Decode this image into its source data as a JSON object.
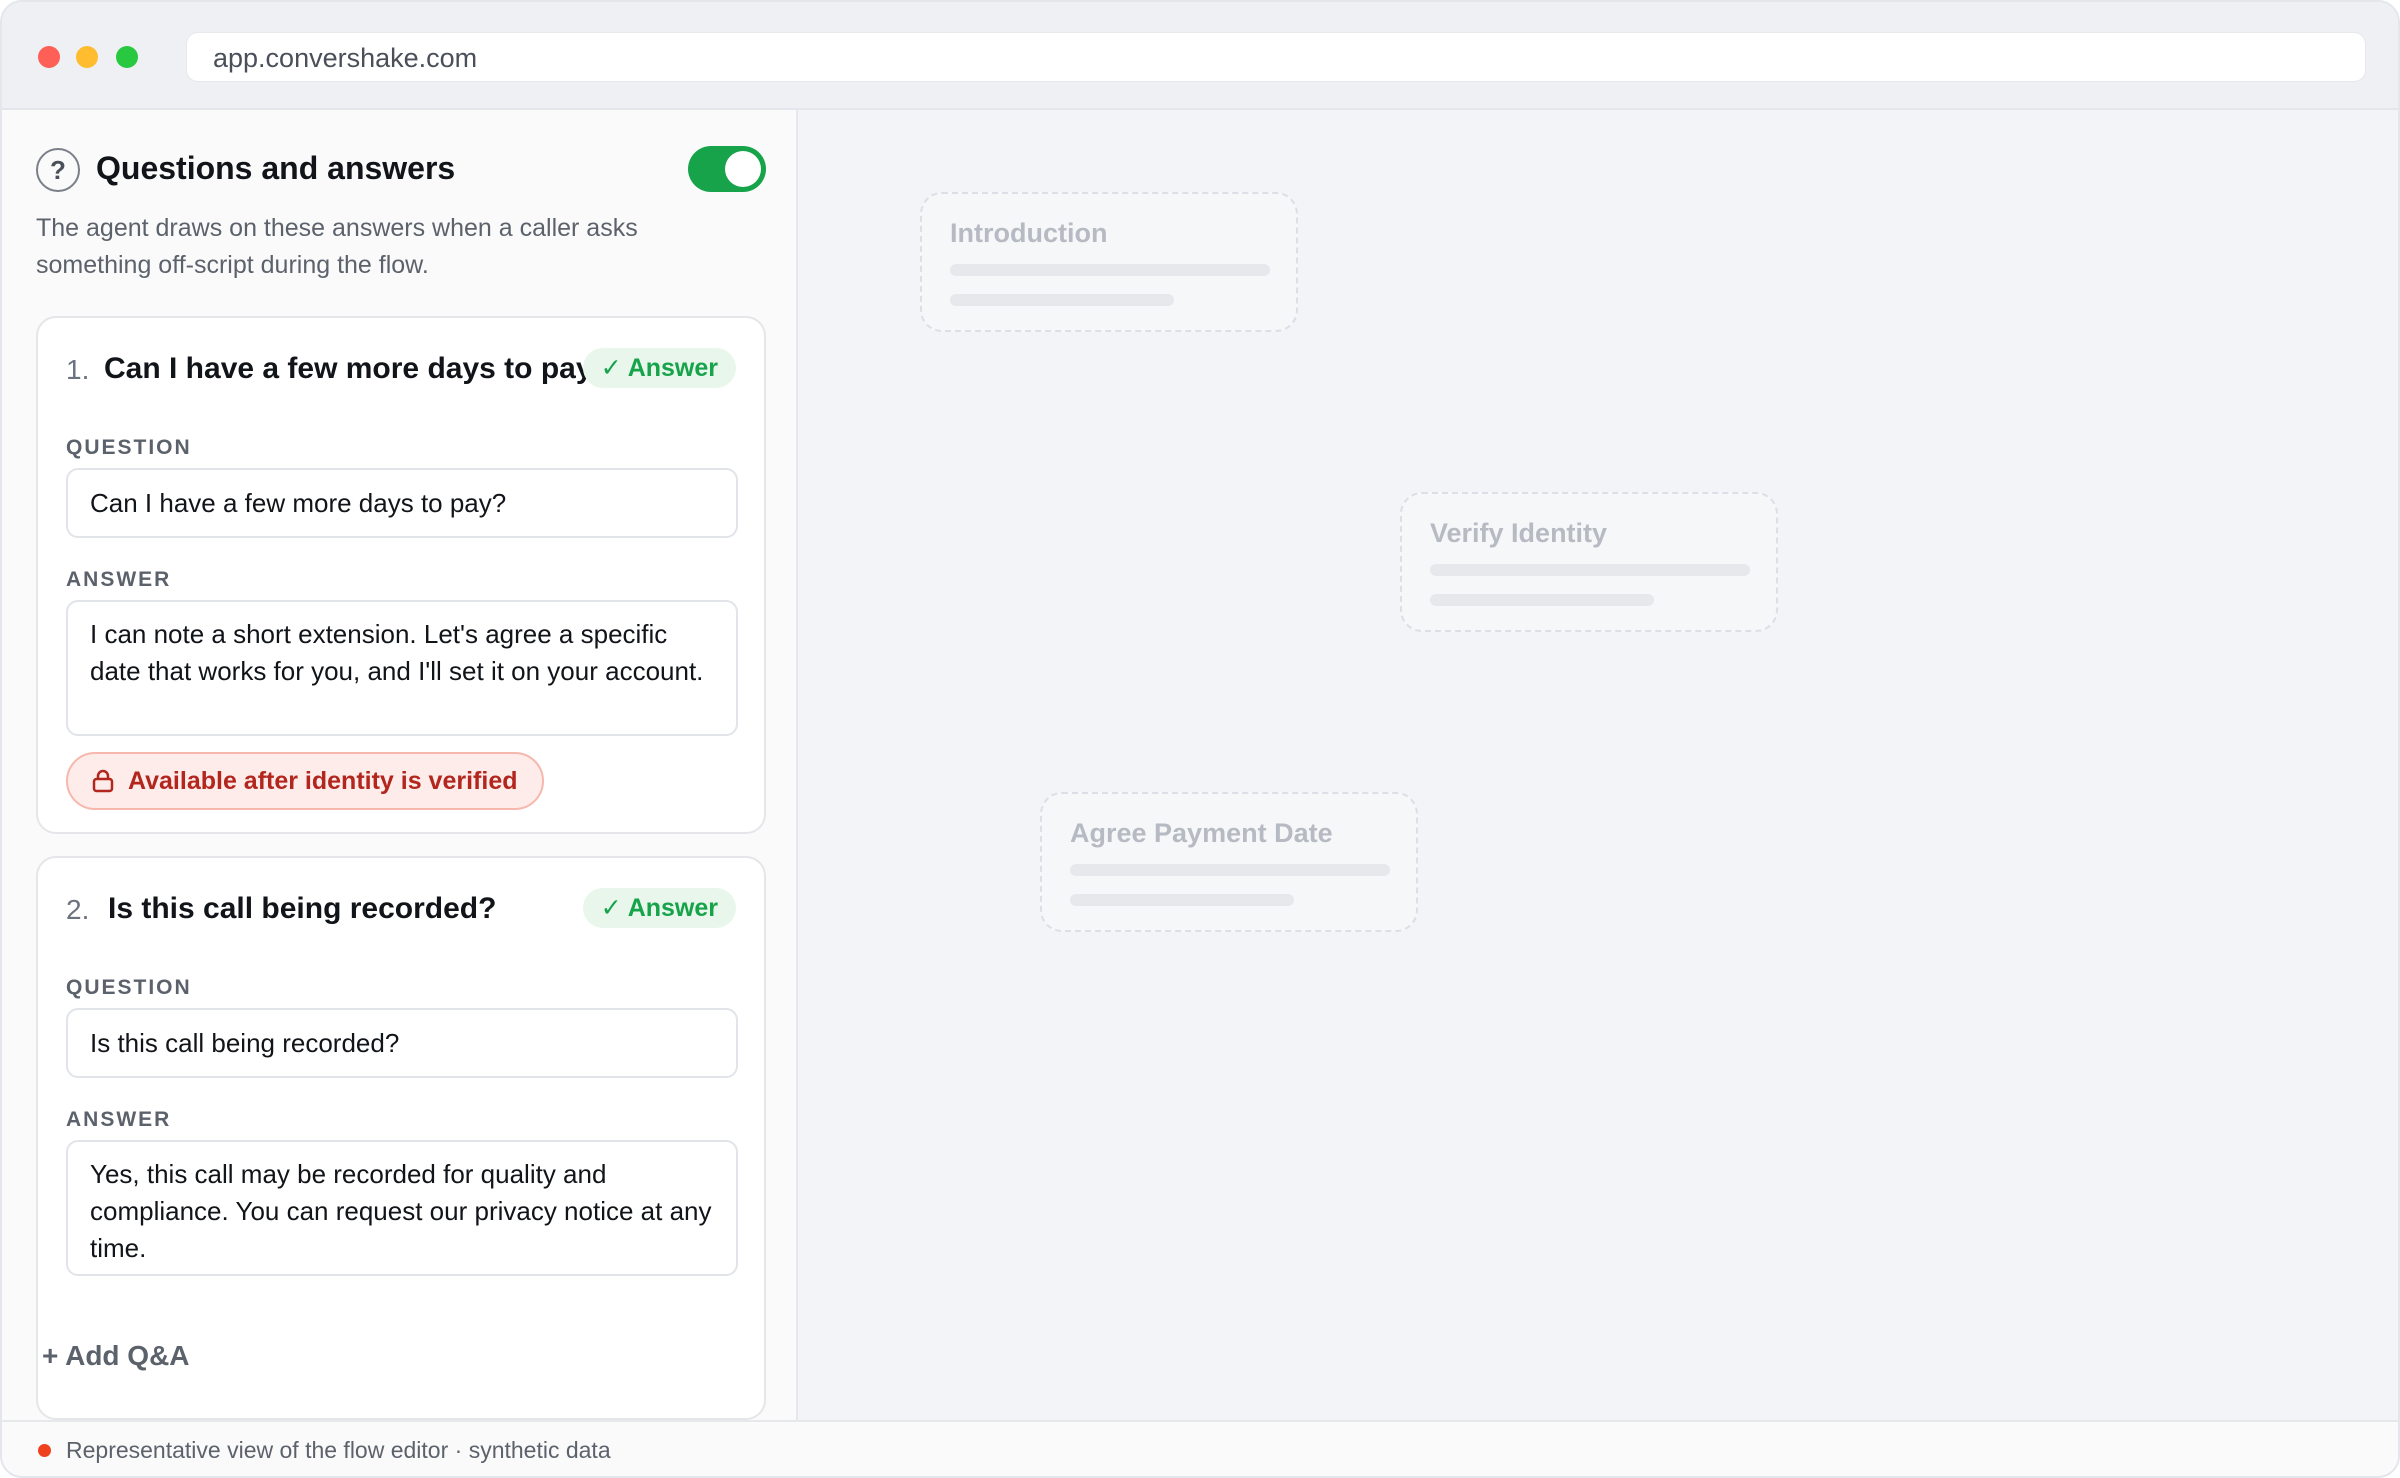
{
  "browser": {
    "url": "app.convershake.com"
  },
  "panel": {
    "title": "Questions and answers",
    "description": "The agent draws on these answers when a caller asks something off-script during the flow.",
    "toggle_on": true,
    "help_icon": "question-circle-icon",
    "help_glyph": "?"
  },
  "qa_items": [
    {
      "number": "1.",
      "title": "Can I have a few more days to pay?",
      "badge": "Answer",
      "question_label": "QUESTION",
      "question": "Can I have a few more days to pay?",
      "answer_label": "ANSWER",
      "answer": "I can note a short extension. Let's agree a specific date that works for you, and I'll set it on your account.",
      "condition": "Available after identity is verified"
    },
    {
      "number": "2.",
      "title": "Is this call being recorded?",
      "badge": "Answer",
      "question_label": "QUESTION",
      "question": "Is this call being recorded?",
      "answer_label": "ANSWER",
      "answer": "Yes, this call may be recorded for quality and compliance. You can request our privacy notice at any time."
    }
  ],
  "add_button": "+ Add Q&A",
  "canvas_nodes": [
    {
      "title": "Introduction"
    },
    {
      "title": "Verify Identity"
    },
    {
      "title": "Agree Payment Date"
    }
  ],
  "footer": {
    "text": "Representative view of the flow editor · synthetic data"
  },
  "colors": {
    "accent_green": "#16a34a",
    "warning_red": "#b3261e",
    "footer_dot": "#f0411f"
  }
}
